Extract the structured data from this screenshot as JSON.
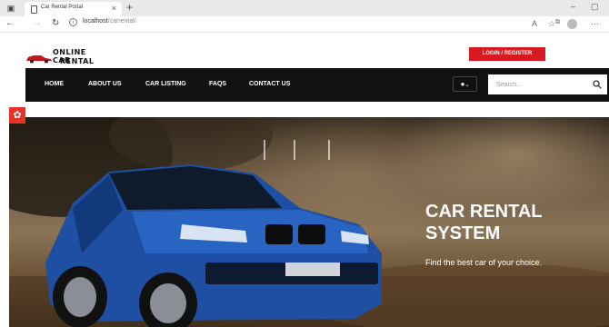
{
  "browser": {
    "tab_title": "Car Rental Portal",
    "new_tab": "+",
    "url_host": "localhost",
    "url_path": "/carrental/"
  },
  "site": {
    "logo_line1": "ONLINE CAR",
    "logo_line2": "RENTAL",
    "login_label": "LOGIN / REGISTER",
    "nav": [
      "HOME",
      "ABOUT US",
      "CAR LISTING",
      "FAQS",
      "CONTACT US"
    ],
    "search_placeholder": "Search...",
    "accent": "#d71920"
  },
  "hero": {
    "title": "CAR RENTAL SYSTEM",
    "subtitle": "Find the best car of your choice."
  }
}
